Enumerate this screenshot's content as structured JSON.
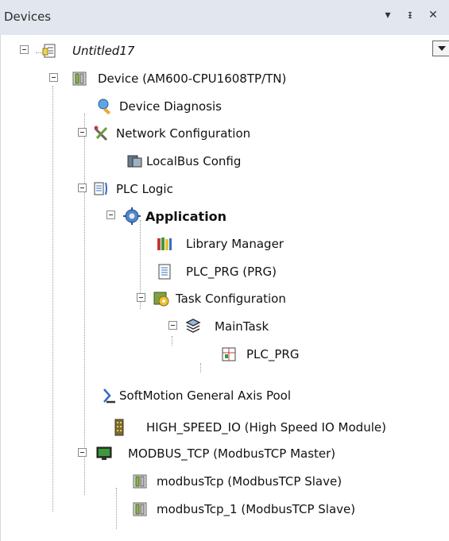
{
  "panel": {
    "title": "Devices",
    "btn_dropdown": "▾",
    "btn_pin": "ᵻ",
    "btn_close": "✕"
  },
  "tree": [
    {
      "id": "untitled17",
      "label": "Untitled17",
      "icon": "project-icon"
    },
    {
      "id": "device",
      "label": "Device (AM600-CPU1608TP/TN)",
      "icon": "device-icon"
    },
    {
      "id": "device-diagnosis",
      "label": "Device Diagnosis",
      "icon": "magnifier-icon"
    },
    {
      "id": "network-config",
      "label": "Network Configuration",
      "icon": "network-config-icon"
    },
    {
      "id": "localbus-config",
      "label": "LocalBus Config",
      "icon": "localbus-icon"
    },
    {
      "id": "plc-logic",
      "label": "PLC Logic",
      "icon": "plc-logic-icon"
    },
    {
      "id": "application",
      "label": "Application",
      "icon": "gear-icon"
    },
    {
      "id": "library-manager",
      "label": "Library Manager",
      "icon": "library-books-icon"
    },
    {
      "id": "plc-prg",
      "label": "PLC_PRG (PRG)",
      "icon": "document-icon"
    },
    {
      "id": "task-configuration",
      "label": "Task Configuration",
      "icon": "task-config-icon"
    },
    {
      "id": "maintask",
      "label": "MainTask",
      "icon": "maintask-icon"
    },
    {
      "id": "plc-prg-call",
      "label": "PLC_PRG",
      "icon": "program-call-icon"
    },
    {
      "id": "softmotion",
      "label": "SoftMotion General Axis Pool",
      "icon": "axis-pool-icon"
    },
    {
      "id": "high-speed-io",
      "label": "HIGH_SPEED_IO (High Speed IO Module)",
      "icon": "io-module-icon"
    },
    {
      "id": "modbus-tcp",
      "label": "MODBUS_TCP (ModbusTCP Master)",
      "icon": "monitor-icon"
    },
    {
      "id": "modbustcp",
      "label": "modbusTcp (ModbusTCP Slave)",
      "icon": "slave-device-icon"
    },
    {
      "id": "modbustcp-1",
      "label": "modbusTcp_1 (ModbusTCP Slave)",
      "icon": "slave-device-icon"
    }
  ],
  "colors": {
    "titlebar_bg": "#e2e6ee",
    "tree_line": "#9a9a9a",
    "accent_blue": "#2f6fc4",
    "gear_blue": "#4f86c6",
    "module_green": "#6d9b3a"
  }
}
